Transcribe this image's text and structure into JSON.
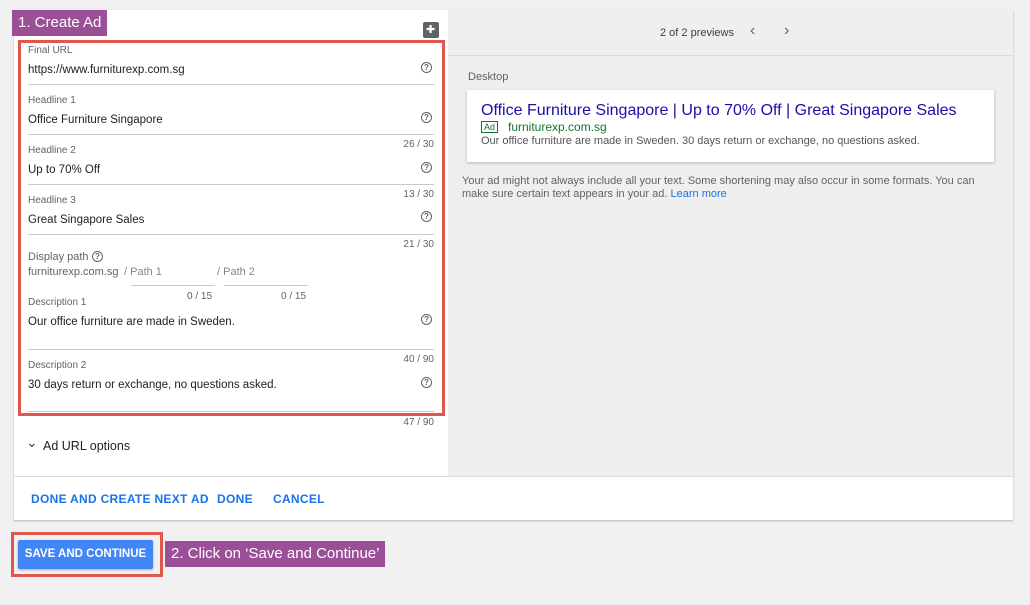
{
  "annotations": {
    "step1": "1. Create Ad",
    "step2": "2. Click on ‘Save and Continue’"
  },
  "form": {
    "final_url": {
      "label": "Final URL",
      "value": "https://www.furniturexp.com.sg"
    },
    "headline1": {
      "label": "Headline 1",
      "value": "Office Furniture Singapore",
      "counter": "26 / 30"
    },
    "headline2": {
      "label": "Headline 2",
      "value": "Up to 70% Off",
      "counter": "13 / 30"
    },
    "headline3": {
      "label": "Headline 3",
      "value": "Great Singapore Sales",
      "counter": "21 / 30"
    },
    "display_path": {
      "label": "Display path",
      "domain": "furniturexp.com.sg",
      "path1_placeholder": "/ Path 1",
      "path2_placeholder": "/ Path 2",
      "path1_counter": "0 / 15",
      "path2_counter": "0 / 15"
    },
    "description1": {
      "label": "Description 1",
      "value": "Our office furniture are made in Sweden.",
      "counter": "40 / 90"
    },
    "description2": {
      "label": "Description 2",
      "value": "30 days return or exchange, no questions asked.",
      "counter": "47 / 90"
    },
    "ad_url_options": "Ad URL options",
    "help_glyph": "?",
    "chevron_glyph": "⌄"
  },
  "preview": {
    "counter_text": "2 of 2 previews",
    "prev_glyph": "‹",
    "next_glyph": "›",
    "device_label": "Desktop",
    "ad": {
      "headline": "Office Furniture Singapore | Up to 70% Off | Great Singapore Sales",
      "badge": "Ad",
      "display_url": "furniturexp.com.sg",
      "description": "Our office furniture are made in Sweden. 30 days return or exchange, no questions asked."
    },
    "disclaimer": "Your ad might not always include all your text. Some shortening may also occur in some formats. You can make sure certain text appears in your ad.",
    "learn_more": "Learn more"
  },
  "actions": {
    "done_and_create_next": "DONE AND CREATE NEXT AD",
    "done": "DONE",
    "cancel": "CANCEL",
    "save_and_continue": "SAVE AND CONTINUE"
  },
  "colors": {
    "accent_blue": "#1a73e8",
    "button_blue": "#4285f4",
    "annotation_purple": "#9b4f97",
    "annotation_red": "#e0584d",
    "ad_headline": "#1a0dab",
    "ad_url_green": "#137333"
  }
}
